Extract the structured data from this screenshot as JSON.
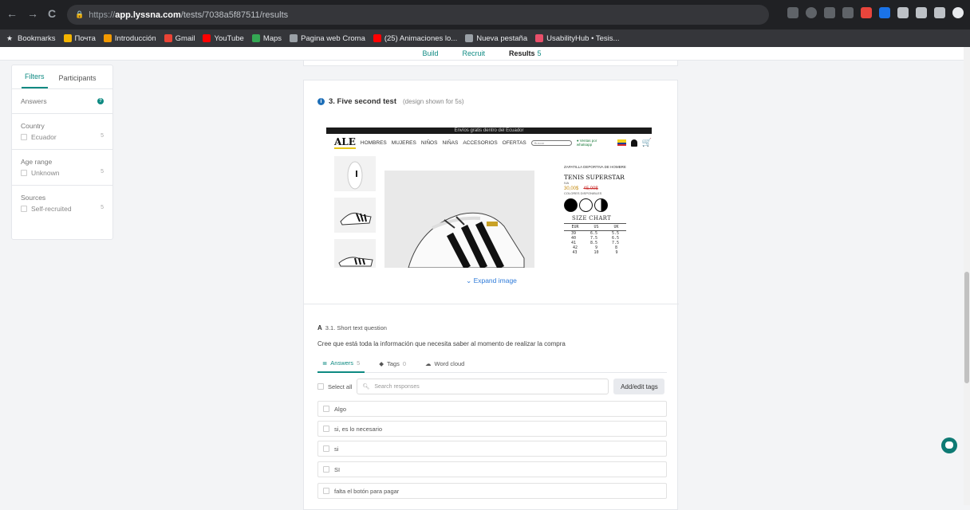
{
  "browser": {
    "url_scheme": "https://",
    "url_host": "app.lyssna.com",
    "url_path": "/tests/7038a5f87511/results",
    "nav": {
      "back": "←",
      "forward": "→",
      "reload": "C"
    },
    "bookmarks": [
      {
        "label": "Bookmarks",
        "color": "#e8eaed"
      },
      {
        "label": "Почта",
        "color": "#f4b400"
      },
      {
        "label": "Introducción",
        "color": "#f29900"
      },
      {
        "label": "Gmail",
        "color": "#ea4335"
      },
      {
        "label": "YouTube",
        "color": "#ff0000"
      },
      {
        "label": "Maps",
        "color": "#34a853"
      },
      {
        "label": "Pagina web Croma",
        "color": "#9aa0a6"
      },
      {
        "label": "(25) Animaciones lo...",
        "color": "#ff0000"
      },
      {
        "label": "Nueva pestaña",
        "color": "#9aa0a6"
      },
      {
        "label": "UsabilityHub • Tesis...",
        "color": "#e94f6a"
      }
    ]
  },
  "steps": {
    "build": "Build",
    "recruit": "Recruit",
    "results": "Results",
    "results_count": "5"
  },
  "sidebar": {
    "tabs": [
      "Filters",
      "Participants"
    ],
    "answers_label": "Answers",
    "sections": [
      {
        "title": "Country",
        "option": "Ecuador",
        "count": "5"
      },
      {
        "title": "Age range",
        "option": "Unknown",
        "count": "5"
      },
      {
        "title": "Sources",
        "option": "Self-recruited",
        "count": "5"
      }
    ]
  },
  "question": {
    "title": "3. Five second test",
    "subtitle": "(design shown for 5s)",
    "expand_label": "Expand image"
  },
  "shop_image": {
    "banner": "Envíos gratis dentro del Ecuador",
    "logo": "ALE",
    "nav": [
      "HOMBRES",
      "MUJERES",
      "NIÑOS",
      "NIÑAS",
      "ACCESORIOS",
      "OFERTAS"
    ],
    "search_placeholder": "Buscar",
    "whatsapp": "Ventas por whatsapp",
    "category": "ZAPATILLA DEPORTIVA DE HOMBRE",
    "product_name": "TENIS SUPERSTAR",
    "tax_note": "IVA",
    "price": "30,00$",
    "old_price": "45,00$",
    "colors_label": "COLORES DISPONIBLES",
    "size_chart_title": "SIZE CHART",
    "size_headers": [
      "EUR",
      "US",
      "UK"
    ],
    "size_rows": [
      [
        "39",
        "6.5",
        "5.5"
      ],
      [
        "40",
        "7.5",
        "6.5"
      ],
      [
        "41",
        "8.5",
        "7.5"
      ],
      [
        "42",
        "9",
        "8"
      ],
      [
        "43",
        "10",
        "9"
      ]
    ]
  },
  "subquestion": {
    "label": "3.1. Short text question",
    "text": "Cree que está toda la información que necesita saber al momento de realizar la compra"
  },
  "results_tabs": [
    {
      "label": "Answers",
      "count": "5"
    },
    {
      "label": "Tags",
      "count": "0"
    },
    {
      "label": "Word cloud",
      "count": ""
    }
  ],
  "toolbar": {
    "select_all": "Select all",
    "search_placeholder": "Search responses",
    "tags_button": "Add/edit tags"
  },
  "answers": [
    "Algo",
    "si, es lo necesario",
    "si",
    "SI",
    "falta el botón para pagar"
  ]
}
